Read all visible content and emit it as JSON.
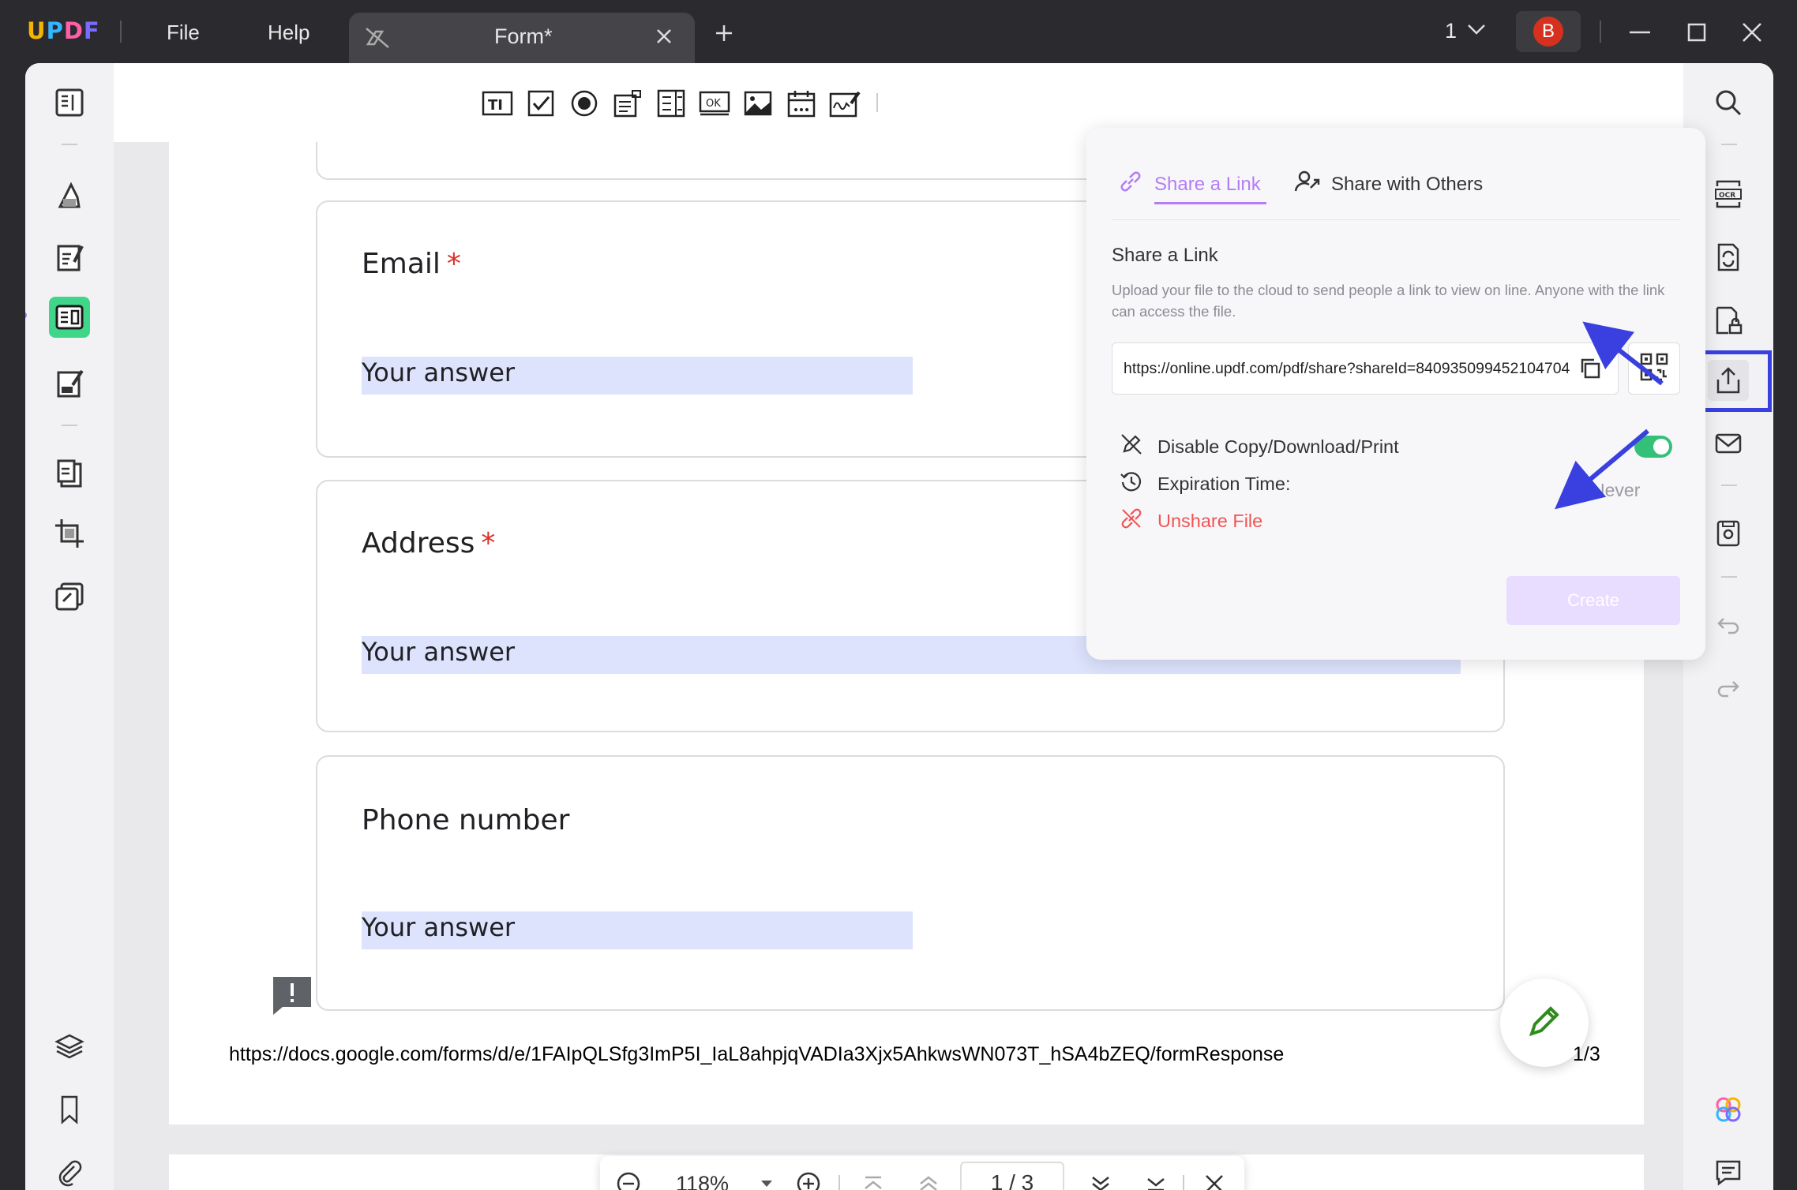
{
  "app": {
    "logo": "UPDF",
    "menu": [
      "File",
      "Help"
    ],
    "tab_title": "Form*",
    "page_indicator": "1",
    "avatar_initial": "B"
  },
  "document": {
    "questions": [
      {
        "title": "Email",
        "required": "*",
        "answer_placeholder": "Your answer"
      },
      {
        "title": "Address",
        "required": "*",
        "answer_placeholder": "Your answer"
      },
      {
        "title": "Phone number",
        "required": "",
        "answer_placeholder": "Your answer"
      }
    ],
    "footer_url": "https://docs.google.com/forms/d/e/1FAIpQLSfg3ImP5I_IaL8ahpjqVADIa3Xjx5AhkwsWN073T_hSA4bZEQ/formResponse",
    "footer_page": "1/3"
  },
  "zoom": {
    "value": "118%",
    "page": "1  /  3"
  },
  "share_panel": {
    "tabs": [
      "Share a Link",
      "Share with Others"
    ],
    "heading": "Share a Link",
    "description": "Upload your file to the cloud to send people a link to view on line. Anyone with the link can access the file.",
    "link": "https://online.updf.com/pdf/share?shareId=840935099452104704",
    "disable_label": "Disable Copy/Download/Print",
    "disable_enabled": true,
    "expiration_label": "Expiration Time:",
    "expiration_value": "Never",
    "unshare_label": "Unshare File",
    "create_label": "Create"
  },
  "colors": {
    "accent": "#b57cf5",
    "toggle_on": "#35c07a",
    "danger": "#f05454",
    "highlight": "#3a40e0",
    "answer_fill": "#dde3fd"
  }
}
